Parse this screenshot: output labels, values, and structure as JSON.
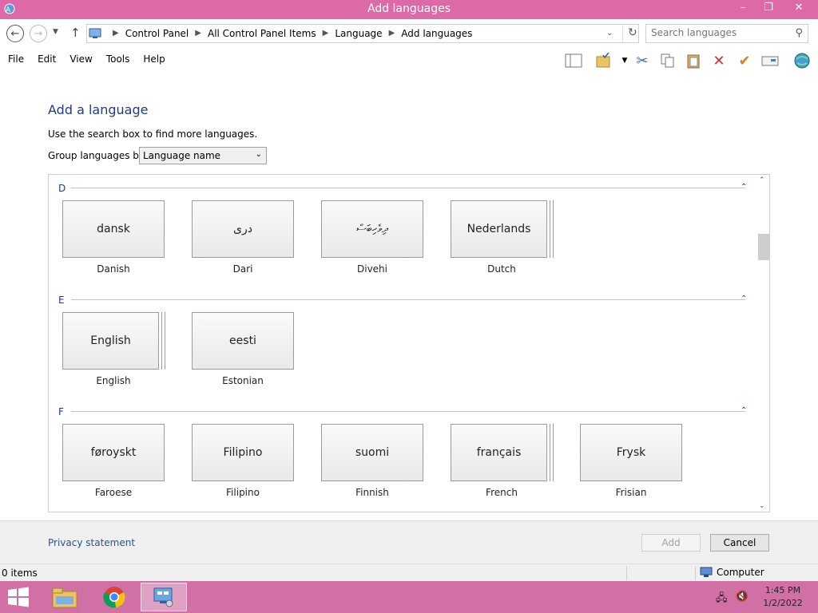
{
  "window": {
    "title": "Add languages",
    "minimize": "–",
    "maximize": "❐",
    "close": "✕"
  },
  "address": {
    "crumbs": [
      "Control Panel",
      "All Control Panel Items",
      "Language",
      "Add languages"
    ],
    "search_placeholder": "Search languages"
  },
  "menu": [
    "File",
    "Edit",
    "View",
    "Tools",
    "Help"
  ],
  "page": {
    "heading": "Add a language",
    "hint": "Use the search box to find more languages.",
    "group_label": "Group languages by:",
    "group_value": "Language name"
  },
  "sections": [
    {
      "letter": "D",
      "languages": [
        {
          "native": "dansk",
          "name": "Danish",
          "stack": false
        },
        {
          "native": "دری",
          "name": "Dari",
          "stack": false
        },
        {
          "native": "ދިވެހިބަސް",
          "name": "Divehi",
          "stack": false
        },
        {
          "native": "Nederlands",
          "name": "Dutch",
          "stack": true
        }
      ]
    },
    {
      "letter": "E",
      "languages": [
        {
          "native": "English",
          "name": "English",
          "stack": true
        },
        {
          "native": "eesti",
          "name": "Estonian",
          "stack": false
        }
      ]
    },
    {
      "letter": "F",
      "languages": [
        {
          "native": "føroyskt",
          "name": "Faroese",
          "stack": false
        },
        {
          "native": "Filipino",
          "name": "Filipino",
          "stack": false
        },
        {
          "native": "suomi",
          "name": "Finnish",
          "stack": false
        },
        {
          "native": "français",
          "name": "French",
          "stack": true
        },
        {
          "native": "Frysk",
          "name": "Frisian",
          "stack": false
        }
      ]
    }
  ],
  "footer": {
    "privacy": "Privacy statement",
    "add": "Add",
    "cancel": "Cancel"
  },
  "status": {
    "items": "0 items",
    "location": "Computer"
  },
  "clock": {
    "time": "1:45 PM",
    "date": "1/2/2022"
  },
  "colors": {
    "titlebar": "#dd6aa7",
    "taskbar": "#d070a5",
    "heading": "#1e3b8a",
    "link": "#1e55a8"
  }
}
